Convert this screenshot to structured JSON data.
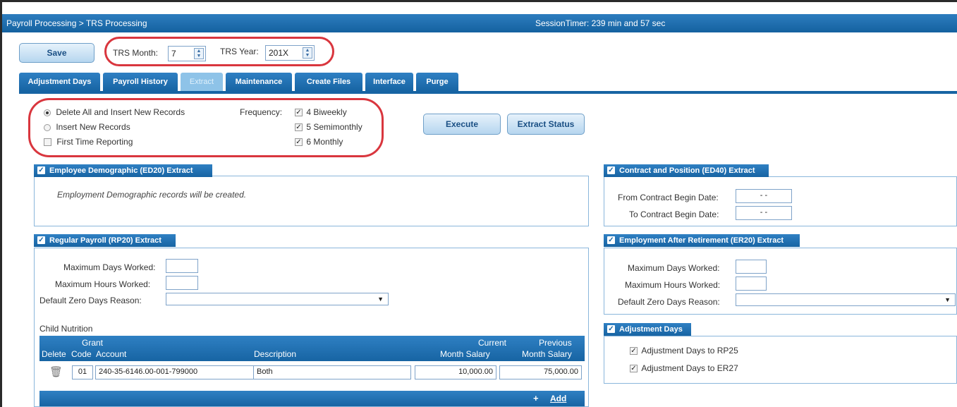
{
  "header": {
    "breadcrumb": "Payroll Processing > TRS Processing",
    "session_timer": "SessionTimer: 239 min and 57 sec"
  },
  "toolbar": {
    "save_label": "Save",
    "trs_month_label": "TRS Month:",
    "trs_month_value": "7",
    "trs_year_label": "TRS Year:",
    "trs_year_value": "201X"
  },
  "tabs": [
    {
      "label": "Adjustment Days",
      "active": false
    },
    {
      "label": "Payroll History",
      "active": false
    },
    {
      "label": "Extract",
      "active": true
    },
    {
      "label": "Maintenance",
      "active": false
    },
    {
      "label": "Create Files",
      "active": false
    },
    {
      "label": "Interface",
      "active": false
    },
    {
      "label": "Purge",
      "active": false
    }
  ],
  "options": {
    "radio_delete_all": "Delete All and Insert New Records",
    "radio_insert_new": "Insert New Records",
    "first_time": "First Time Reporting",
    "frequency_label": "Frequency:",
    "freq_biweekly": "4 Biweekly",
    "freq_semimonthly": "5 Semimonthly",
    "freq_monthly": "6 Monthly",
    "selected_radio": "delete_all"
  },
  "actions": {
    "execute_label": "Execute",
    "extract_status_label": "Extract Status"
  },
  "ed20": {
    "title": "Employee Demographic (ED20) Extract",
    "message": "Employment Demographic records will be created."
  },
  "rp20": {
    "title": "Regular Payroll (RP20) Extract",
    "max_days_label": "Maximum Days Worked:",
    "max_hours_label": "Maximum Hours Worked:",
    "zero_days_label": "Default Zero Days Reason:",
    "child_nutrition_label": "Child Nutrition",
    "col_grant": "Grant",
    "col_delete": "Delete",
    "col_code": "Code",
    "col_account": "Account",
    "col_description": "Description",
    "col_current": "Current",
    "col_current_2": "Month Salary",
    "col_previous": "Previous",
    "col_previous_2": "Month Salary",
    "row": {
      "code": "01",
      "account": "240-35-6146.00-001-799000",
      "description": "Both",
      "current": "10,000.00",
      "previous": "75,000.00"
    },
    "add_label": "Add"
  },
  "ed40": {
    "title": "Contract and Position (ED40) Extract",
    "from_label": "From Contract Begin Date:",
    "to_label": "To Contract Begin Date:",
    "from_value": "- -",
    "to_value": "- -"
  },
  "er20": {
    "title": "Employment After Retirement (ER20) Extract",
    "max_days_label": "Maximum Days Worked:",
    "max_hours_label": "Maximum Hours Worked:",
    "zero_days_label": "Default Zero Days Reason:"
  },
  "adj": {
    "title": "Adjustment Days",
    "rp25": "Adjustment Days to RP25",
    "er27": "Adjustment Days to ER27"
  },
  "colors": {
    "header_blue": "#1764a3",
    "highlight_red": "#d9363e"
  }
}
